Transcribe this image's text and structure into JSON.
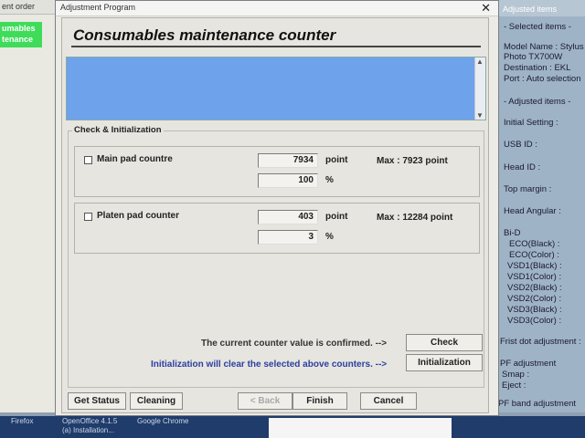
{
  "left_window": {
    "title": "ent order",
    "green_label_1": "umables",
    "green_label_2": "tenance"
  },
  "right_panel": {
    "title": "Adjusted items",
    "lines": [
      "- Selected items -",
      "Model Name : Stylus",
      "Photo TX700W",
      "Destination : EKL",
      "Port : Auto selection",
      "- Adjusted items -",
      "Initial Setting :",
      "USB ID :",
      "Head ID :",
      "Top margin :",
      "Head Angular :",
      "Bi-D",
      "ECO(Black) :",
      "ECO(Color) :",
      "VSD1(Black) :",
      "VSD1(Color) :",
      "VSD2(Black) :",
      "VSD2(Color) :",
      "VSD3(Black) :",
      "VSD3(Color) :",
      "Frist dot adjustment :",
      "PF adjustment",
      "Smap :",
      "Eject :",
      "PF band adjustment"
    ]
  },
  "dialog": {
    "title": "Adjustment Program",
    "close_glyph": "✕",
    "heading": "Consumables maintenance counter",
    "group_title": "Check & Initialization",
    "main_pad": {
      "label": "Main pad countre",
      "value": "7934",
      "unit": "point",
      "percent": "100",
      "percent_unit": "%",
      "max": "Max : 7923 point"
    },
    "platen_pad": {
      "label": "Platen pad counter",
      "value": "403",
      "unit": "point",
      "percent": "3",
      "percent_unit": "%",
      "max": "Max : 12284 point"
    },
    "confirm_message": "The current counter value is confirmed.  -->",
    "init_message": "Initialization will clear the selected above counters.  -->",
    "check_button": "Check",
    "initialization_button": "Initialization",
    "get_status_button": "Get Status",
    "cleaning_button": "Cleaning",
    "back_button": "< Back",
    "finish_button": "Finish",
    "cancel_button": "Cancel"
  },
  "taskbar": {
    "item_1": "Firefox",
    "item_2": "OpenOffice 4.1.5",
    "item_3": "(a) Installation...",
    "item_4": "Google Chrome"
  }
}
